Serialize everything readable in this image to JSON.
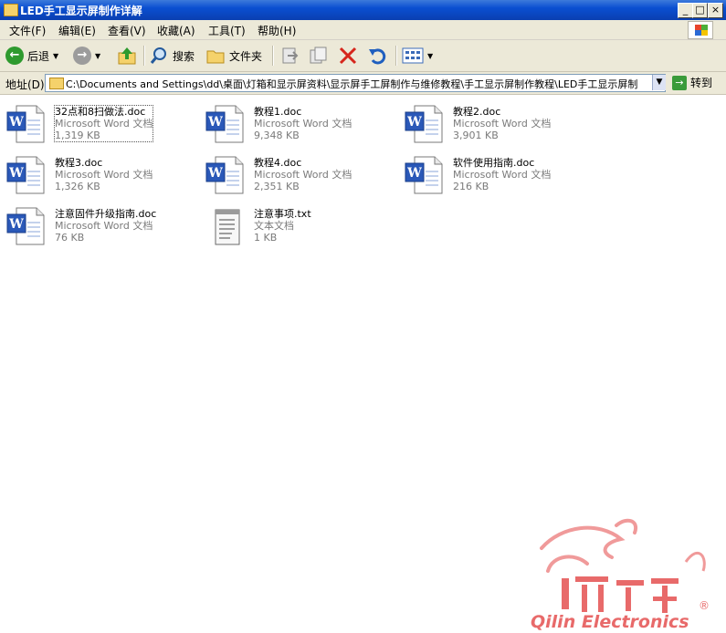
{
  "window": {
    "title": "LED手工显示屏制作详解"
  },
  "window_buttons": [
    "_",
    "□",
    "×"
  ],
  "menu": [
    {
      "label": "文件(F)"
    },
    {
      "label": "编辑(E)"
    },
    {
      "label": "查看(V)"
    },
    {
      "label": "收藏(A)"
    },
    {
      "label": "工具(T)"
    },
    {
      "label": "帮助(H)"
    }
  ],
  "toolbar": {
    "back": "后退",
    "search": "搜索",
    "folders": "文件夹"
  },
  "address": {
    "label": "地址(D)",
    "path": "C:\\Documents and Settings\\dd\\桌面\\灯箱和显示屏资料\\显示屏手工屏制作与维修教程\\手工显示屏制作教程\\LED手工显示屏制",
    "go": "转到"
  },
  "files": [
    {
      "name": "32点和8扫做法.doc",
      "type": "Microsoft Word 文档",
      "size": "1,319 KB",
      "icon": "word-doc-icon"
    },
    {
      "name": "教程1.doc",
      "type": "Microsoft Word 文档",
      "size": "9,348 KB",
      "icon": "word-doc-icon"
    },
    {
      "name": "教程2.doc",
      "type": "Microsoft Word 文档",
      "size": "3,901 KB",
      "icon": "word-doc-icon"
    },
    {
      "name": "教程3.doc",
      "type": "Microsoft Word 文档",
      "size": "1,326 KB",
      "icon": "word-doc-icon"
    },
    {
      "name": "教程4.doc",
      "type": "Microsoft Word 文档",
      "size": "2,351 KB",
      "icon": "word-doc-icon"
    },
    {
      "name": "软件使用指南.doc",
      "type": "Microsoft Word 文档",
      "size": "216 KB",
      "icon": "word-doc-icon"
    },
    {
      "name": "注意固件升级指南.doc",
      "type": "Microsoft Word 文档",
      "size": "76 KB",
      "icon": "word-doc-icon"
    },
    {
      "name": "注意事项.txt",
      "type": "文本文档",
      "size": "1 KB",
      "icon": "text-doc-icon"
    }
  ],
  "watermark": {
    "brand": "Qilin Electronics",
    "mark": "®"
  },
  "colors": {
    "titlebar": "#0a4fd1",
    "chrome": "#ece9d8",
    "word_blue": "#2a58b8",
    "watermark": "#e86a6a"
  }
}
